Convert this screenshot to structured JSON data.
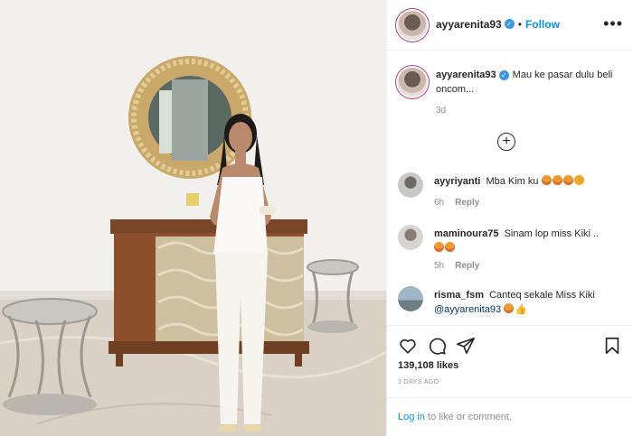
{
  "post": {
    "author": "ayyarenita93",
    "follow_label": "Follow",
    "separator": "•",
    "more_label": "•••"
  },
  "caption": {
    "username": "ayyarenita93",
    "text": "Mau ke pasar dulu beli oncom...",
    "age": "3d"
  },
  "load_more": "+",
  "comments": [
    {
      "username": "ayyriyanti",
      "text": "Mba Kim ku",
      "age": "6h",
      "reply": "Reply"
    },
    {
      "username": "maminoura75",
      "text": "Sinam lop miss Kiki ..",
      "age": "5h",
      "reply": "Reply"
    },
    {
      "username": "risma_fsm",
      "text": "Canteq sekale Miss Kiki",
      "mention": "@ayyarenita93"
    }
  ],
  "likes": "139,108 likes",
  "posted": "3 DAYS AGO",
  "login": {
    "link": "Log in",
    "text": " to like or comment."
  },
  "colors": {
    "link": "#0095f6",
    "verified": "#3897f0",
    "muted": "#8e8e8e",
    "text": "#262626"
  }
}
